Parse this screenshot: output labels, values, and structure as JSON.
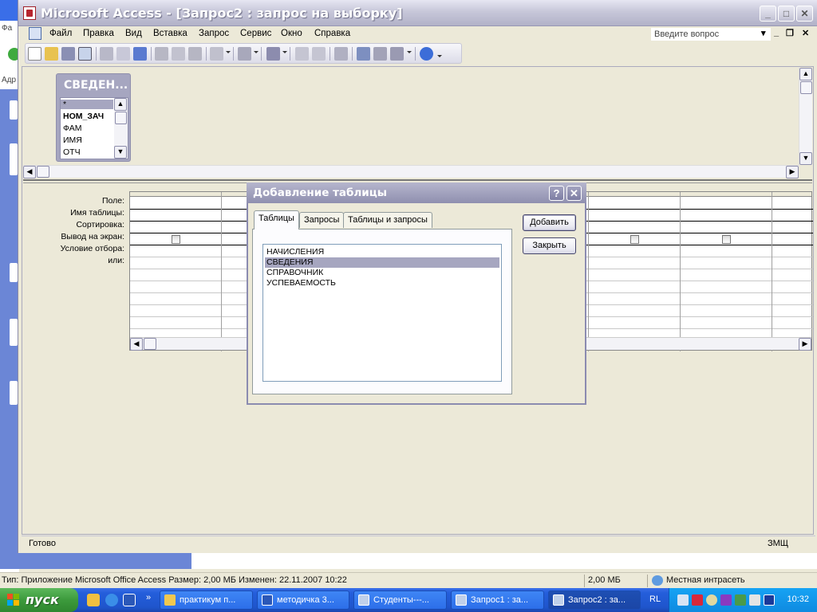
{
  "background": {
    "explorer_labels": [
      "Фа",
      "Адр"
    ]
  },
  "window": {
    "title": "Microsoft Access - [Запрос2 : запрос на выборку]"
  },
  "menu": {
    "items": [
      "Файл",
      "Правка",
      "Вид",
      "Вставка",
      "Запрос",
      "Сервис",
      "Окно",
      "Справка"
    ],
    "help_placeholder": "Введите вопрос"
  },
  "field_list": {
    "title": "СВЕДЕН...",
    "fields": [
      "*",
      "НОМ_ЗАЧ",
      "ФАМ",
      "ИМЯ",
      "ОТЧ"
    ]
  },
  "grid": {
    "row_labels": [
      "Поле:",
      "Имя таблицы:",
      "Сортировка:",
      "Вывод на экран:",
      "Условие отбора:",
      "или:"
    ]
  },
  "status": {
    "left": "Готово",
    "right": "ЗМЩ"
  },
  "dialog": {
    "title": "Добавление таблицы",
    "help_glyph": "?",
    "close_glyph": "✕",
    "tabs": [
      "Таблицы",
      "Запросы",
      "Таблицы и запросы"
    ],
    "tables": [
      "НАЧИСЛЕНИЯ",
      "СВЕДЕНИЯ",
      "СПРАВОЧНИК",
      "УСПЕВАЕМОСТЬ"
    ],
    "selected_table": "СВЕДЕНИЯ",
    "add_button": "Добавить",
    "close_button": "Закрыть"
  },
  "explorer_status": {
    "info": "Тип: Приложение Microsoft Office Access Размер: 2,00 МБ Изменен: 22.11.2007 10:22",
    "size": "2,00 МБ",
    "zone": "Местная интрасеть"
  },
  "taskbar": {
    "start": "пуск",
    "tasks": [
      "практикум п...",
      "методичка 3...",
      "Студенты---...",
      "Запрос1 : за...",
      "Запрос2 : за..."
    ],
    "lang": "RL",
    "clock": "10:32"
  }
}
